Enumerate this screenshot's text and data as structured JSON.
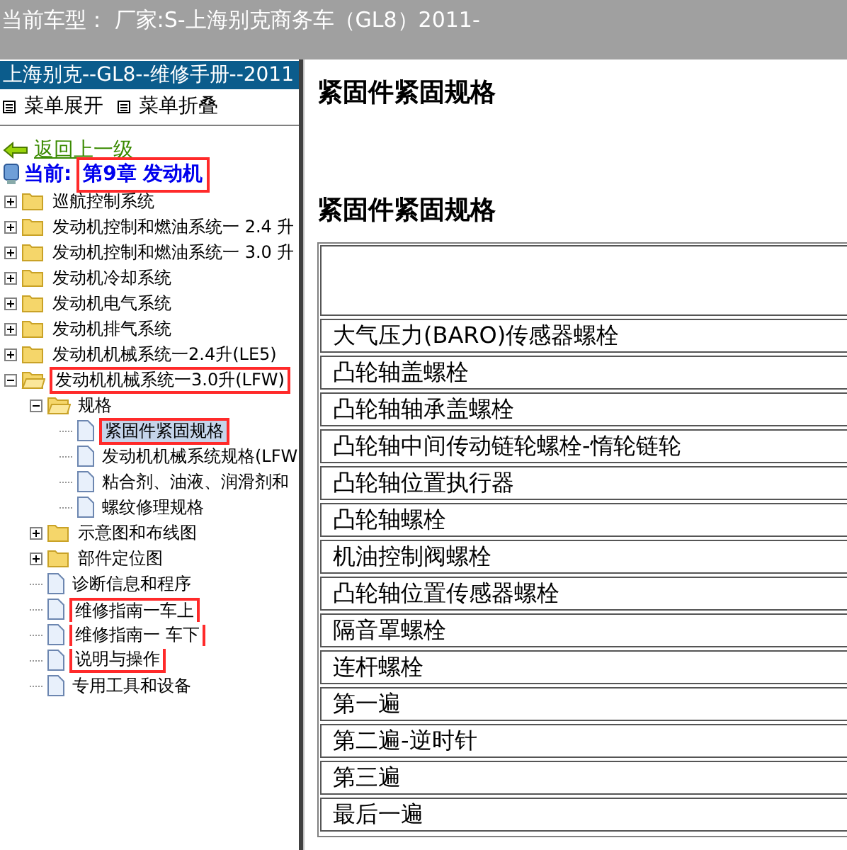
{
  "title_bar": {
    "title": "当前车型： 厂家:S-上海别克商务车（GL8）2011-"
  },
  "sidebar": {
    "header": "上海别克--GL8--维修手册--2011",
    "menu": [
      {
        "label": "菜单展开"
      },
      {
        "label": "菜单折叠"
      }
    ],
    "back_link": "返回上一级",
    "current": {
      "label": "当前:",
      "value": "第9章 发动机",
      "annotated": true
    },
    "tree": [
      {
        "label": "巡航控制系统",
        "kind": "folder",
        "expanded": false
      },
      {
        "label": "发动机控制和燃油系统一 2.4 升",
        "kind": "folder",
        "expanded": false
      },
      {
        "label": "发动机控制和燃油系统一 3.0 升",
        "kind": "folder",
        "expanded": false
      },
      {
        "label": "发动机冷却系统",
        "kind": "folder",
        "expanded": false
      },
      {
        "label": "发动机电气系统",
        "kind": "folder",
        "expanded": false
      },
      {
        "label": "发动机排气系统",
        "kind": "folder",
        "expanded": false
      },
      {
        "label": "发动机机械系统一2.4升(LE5)",
        "kind": "folder",
        "expanded": false
      },
      {
        "label": "发动机机械系统一3.0升(LFW)",
        "kind": "folder",
        "expanded": true,
        "annotated": true,
        "children": [
          {
            "label": "规格",
            "kind": "folder",
            "expanded": true,
            "children": [
              {
                "label": "紧固件紧固规格",
                "kind": "doc",
                "selected": true,
                "annotated": true
              },
              {
                "label": "发动机机械系统规格(LFW",
                "kind": "doc",
                "selected": false
              },
              {
                "label": "粘合剂、油液、润滑剂和",
                "kind": "doc",
                "selected": false
              },
              {
                "label": "螺纹修理规格",
                "kind": "doc",
                "selected": false
              }
            ]
          },
          {
            "label": "示意图和布线图",
            "kind": "folder",
            "expanded": false
          },
          {
            "label": "部件定位图",
            "kind": "folder",
            "expanded": false
          },
          {
            "label": "诊断信息和程序",
            "kind": "doc",
            "selected": false
          },
          {
            "label": "维修指南一车上",
            "kind": "doc",
            "selected": false,
            "annotated": true
          },
          {
            "label": "维修指南一 车下",
            "kind": "doc",
            "selected": false,
            "annotated": true
          },
          {
            "label": "说明与操作",
            "kind": "doc",
            "selected": false,
            "annotated": true
          },
          {
            "label": "专用工具和设备",
            "kind": "doc",
            "selected": false
          }
        ]
      }
    ]
  },
  "content": {
    "title": "紧固件紧固规格",
    "section_title": "紧固件紧固规格",
    "table": {
      "rows": [
        "大气压力(BARO)传感器螺栓",
        "凸轮轴盖螺栓",
        "凸轮轴轴承盖螺栓",
        "凸轮轴中间传动链轮螺栓-惰轮链轮",
        "凸轮轴位置执行器",
        "凸轮轴螺栓",
        "机油控制阀螺栓",
        "凸轮轴位置传感器螺栓",
        "隔音罩螺栓",
        "连杆螺栓",
        "第一遍",
        "第二遍-逆时针",
        "第三遍",
        "最后一遍"
      ]
    }
  }
}
